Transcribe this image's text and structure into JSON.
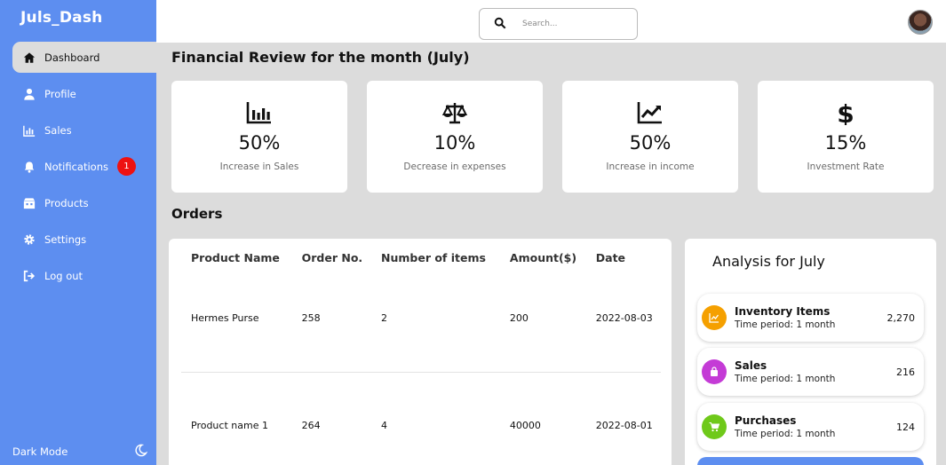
{
  "brand": "Juls_Dash",
  "nav": [
    {
      "label": "Dashboard",
      "icon": "home-icon"
    },
    {
      "label": "Profile",
      "icon": "user-icon"
    },
    {
      "label": "Sales",
      "icon": "bar-chart-icon"
    },
    {
      "label": "Notifications",
      "icon": "bell-icon",
      "badge": "1"
    },
    {
      "label": "Products",
      "icon": "products-icon"
    },
    {
      "label": "Settings",
      "icon": "gear-icon"
    },
    {
      "label": "Log out",
      "icon": "logout-icon"
    }
  ],
  "dark_mode_label": "Dark Mode",
  "search": {
    "placeholder": "Search..."
  },
  "page_title": "Financial Review for the month (July)",
  "cards": [
    {
      "value": "50%",
      "label": "Increase in Sales",
      "icon": "bar-chart-icon"
    },
    {
      "value": "10%",
      "label": "Decrease in expenses",
      "icon": "balance-scale-icon"
    },
    {
      "value": "50%",
      "label": "Increase in income",
      "icon": "trending-up-icon"
    },
    {
      "value": "15%",
      "label": "Investment Rate",
      "icon": "dollar-icon"
    }
  ],
  "orders": {
    "title": "Orders",
    "columns": [
      "Product Name",
      "Order No.",
      "Number of items",
      "Amount($)",
      "Date"
    ],
    "rows": [
      [
        "Hermes Purse",
        "258",
        "2",
        "200",
        "2022-08-03"
      ],
      [
        "Product name 1",
        "264",
        "4",
        "40000",
        "2022-08-01"
      ]
    ]
  },
  "analysis": {
    "title": "Analysis for July",
    "items": [
      {
        "title": "Inventory Items",
        "sub": "Time period: 1 month",
        "value": "2,270",
        "color": "#f5a000",
        "icon": "line-chart-icon"
      },
      {
        "title": "Sales",
        "sub": "Time period: 1 month",
        "value": "216",
        "color": "#c43bd6",
        "icon": "shopping-bag-icon"
      },
      {
        "title": "Purchases",
        "sub": "Time period: 1 month",
        "value": "124",
        "color": "#6fc91a",
        "icon": "cart-icon"
      }
    ]
  },
  "colors": {
    "sidebar": "#5d8ef0",
    "background": "#dcdcdc",
    "badge": "#ee1111"
  }
}
